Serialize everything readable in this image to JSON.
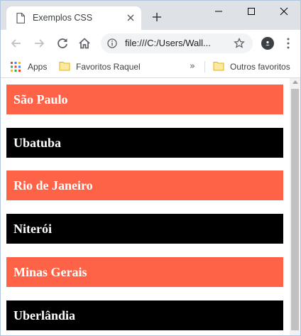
{
  "browser": {
    "tab_title": "Exemplos CSS",
    "url": "file:///C:/Users/Wall...",
    "bookmarks": [
      {
        "label": "Apps",
        "icon": "apps-grid-icon"
      },
      {
        "label": "Favoritos Raquel",
        "icon": "folder-icon"
      },
      {
        "label": "Outros favoritos",
        "icon": "folder-icon"
      }
    ],
    "overflow_chevron": "»"
  },
  "colors": {
    "orange": "#ff6347",
    "black": "#000000",
    "text": "#ffffff"
  },
  "cities": [
    {
      "name": "São Paulo",
      "color": "#ff6347"
    },
    {
      "name": "Ubatuba",
      "color": "#000000"
    },
    {
      "name": "Rio de Janeiro",
      "color": "#ff6347"
    },
    {
      "name": "Niterói",
      "color": "#000000"
    },
    {
      "name": "Minas Gerais",
      "color": "#ff6347"
    },
    {
      "name": "Uberlândia",
      "color": "#000000"
    }
  ]
}
